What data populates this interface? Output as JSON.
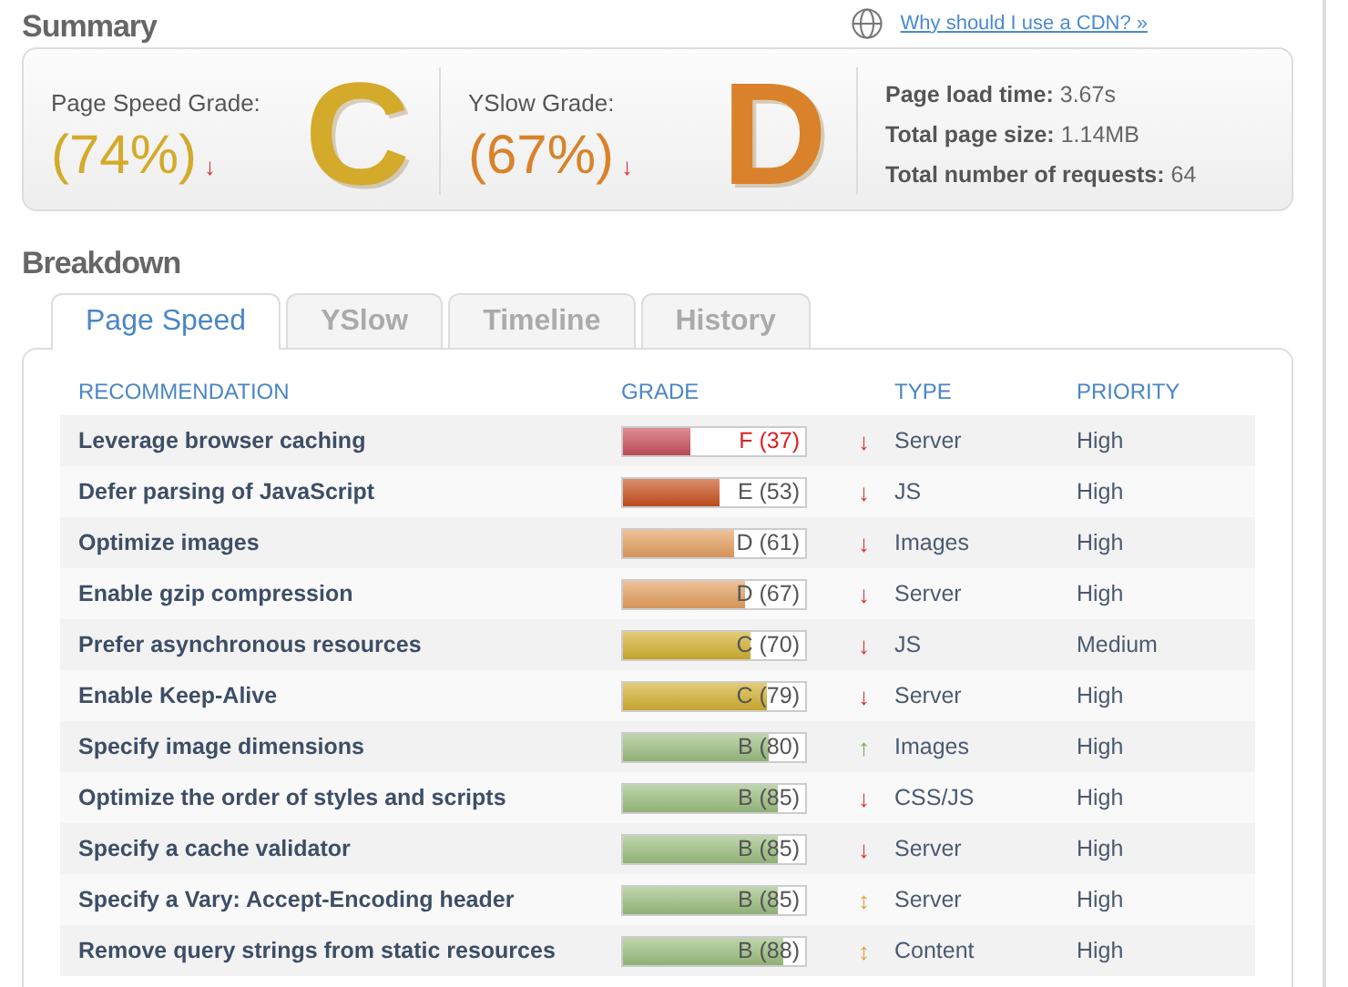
{
  "cdn_link": "Why should I use a CDN? »",
  "summary": {
    "title": "Summary",
    "grades": [
      {
        "label": "Page Speed Grade:",
        "percent": "(74%)",
        "trend": {
          "symbol": "↓",
          "color": "#e03030"
        },
        "letter": "C",
        "color": "#d4aa2a"
      },
      {
        "label": "YSlow Grade:",
        "percent": "(67%)",
        "trend": {
          "symbol": "↓",
          "color": "#e03030"
        },
        "letter": "D",
        "color": "#d9822b"
      }
    ],
    "stats": [
      {
        "label": "Page load time:",
        "value": "3.67s"
      },
      {
        "label": "Total page size:",
        "value": "1.14MB"
      },
      {
        "label": "Total number of requests:",
        "value": "64"
      }
    ]
  },
  "breakdown": {
    "title": "Breakdown",
    "tabs": [
      {
        "label": "Page Speed",
        "selected": true
      },
      {
        "label": "YSlow",
        "selected": false
      },
      {
        "label": "Timeline",
        "selected": false
      },
      {
        "label": "History",
        "selected": false
      }
    ],
    "columns": [
      "RECOMMENDATION",
      "GRADE",
      "TYPE",
      "PRIORITY"
    ],
    "rows": [
      {
        "name": "Leverage browser caching",
        "grade": "F (37)",
        "level": 0.37,
        "color": "#c9505a",
        "alert": true,
        "trend": {
          "symbol": "↓",
          "color": "#e03030"
        },
        "type": "Server",
        "priority": "High"
      },
      {
        "name": "Defer parsing of JavaScript",
        "grade": "E (53)",
        "level": 0.53,
        "color": "#c8501e",
        "alert": false,
        "trend": {
          "symbol": "↓",
          "color": "#e03030"
        },
        "type": "JS",
        "priority": "High"
      },
      {
        "name": "Optimize images",
        "grade": "D (61)",
        "level": 0.61,
        "color": "#e5a060",
        "alert": false,
        "trend": {
          "symbol": "↓",
          "color": "#e03030"
        },
        "type": "Images",
        "priority": "High"
      },
      {
        "name": "Enable gzip compression",
        "grade": "D (67)",
        "level": 0.67,
        "color": "#e5a060",
        "alert": false,
        "trend": {
          "symbol": "↓",
          "color": "#e03030"
        },
        "type": "Server",
        "priority": "High"
      },
      {
        "name": "Prefer asynchronous resources",
        "grade": "C (70)",
        "level": 0.7,
        "color": "#d4b030",
        "alert": false,
        "trend": {
          "symbol": "↓",
          "color": "#e03030"
        },
        "type": "JS",
        "priority": "Medium"
      },
      {
        "name": "Enable Keep-Alive",
        "grade": "C (79)",
        "level": 0.79,
        "color": "#d4b030",
        "alert": false,
        "trend": {
          "symbol": "↓",
          "color": "#e03030"
        },
        "type": "Server",
        "priority": "High"
      },
      {
        "name": "Specify image dimensions",
        "grade": "B (80)",
        "level": 0.8,
        "color": "#9cbf80",
        "alert": false,
        "trend": {
          "symbol": "↑",
          "color": "#7aaa50"
        },
        "type": "Images",
        "priority": "High"
      },
      {
        "name": "Optimize the order of styles and scripts",
        "grade": "B (85)",
        "level": 0.85,
        "color": "#9cbf80",
        "alert": false,
        "trend": {
          "symbol": "↓",
          "color": "#e03030"
        },
        "type": "CSS/JS",
        "priority": "High"
      },
      {
        "name": "Specify a cache validator",
        "grade": "B (85)",
        "level": 0.85,
        "color": "#9cbf80",
        "alert": false,
        "trend": {
          "symbol": "↓",
          "color": "#e03030"
        },
        "type": "Server",
        "priority": "High"
      },
      {
        "name": "Specify a Vary: Accept-Encoding header",
        "grade": "B (85)",
        "level": 0.85,
        "color": "#9cbf80",
        "alert": false,
        "trend": {
          "symbol": "↕",
          "color": "#e8a040"
        },
        "type": "Server",
        "priority": "High"
      },
      {
        "name": "Remove query strings from static resources",
        "grade": "B (88)",
        "level": 0.88,
        "color": "#9cbf80",
        "alert": false,
        "trend": {
          "symbol": "↕",
          "color": "#e8a040"
        },
        "type": "Content",
        "priority": "High"
      }
    ]
  }
}
